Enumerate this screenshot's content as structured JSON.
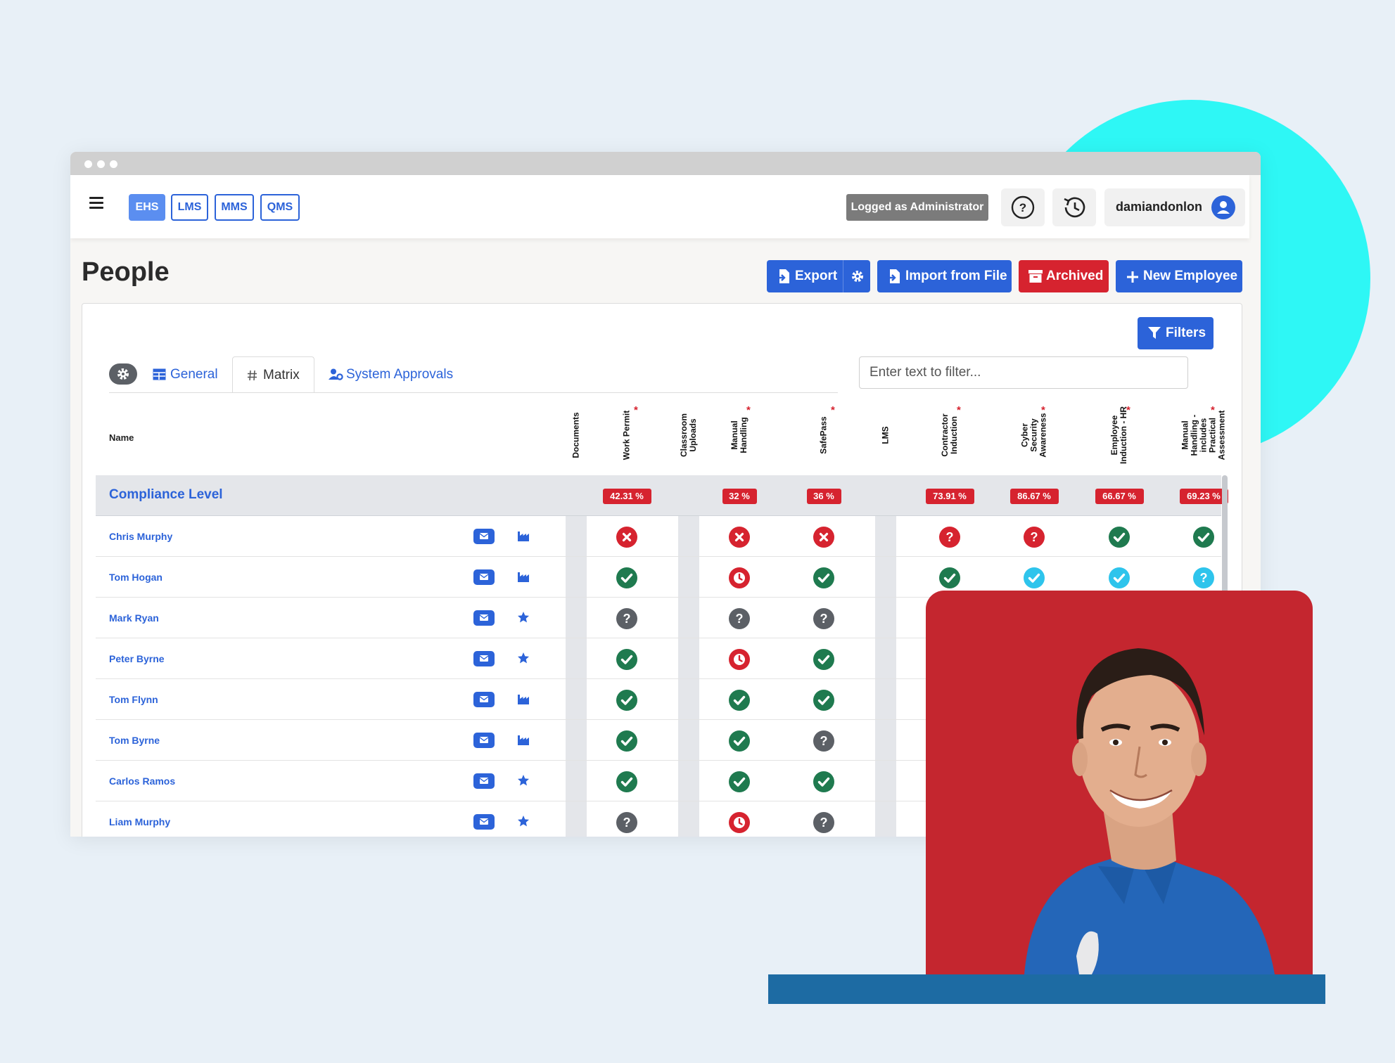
{
  "modules": [
    "EHS",
    "LMS",
    "MMS",
    "QMS"
  ],
  "header": {
    "logged_as": "Logged as Administrator",
    "username": "damiandonlon"
  },
  "page": {
    "title": "People",
    "export_label": "Export",
    "import_label": "Import from File",
    "archived_label": "Archived",
    "new_employee_label": "New Employee"
  },
  "card": {
    "filters_label": "Filters",
    "tabs": [
      "General",
      "Matrix",
      "System Approvals"
    ],
    "active_tab": "Matrix",
    "filter_placeholder": "Enter text to filter...",
    "name_header": "Name"
  },
  "columns": [
    {
      "label": "Documents",
      "required": false,
      "band": true
    },
    {
      "label": "Work Permit",
      "required": true,
      "band": false
    },
    {
      "label": "Classroom Uploads",
      "required": false,
      "band": true
    },
    {
      "label": "Manual Handling",
      "required": true,
      "band": false
    },
    {
      "label": "SafePass",
      "required": true,
      "band": false
    },
    {
      "label": "LMS",
      "required": false,
      "band": true
    },
    {
      "label": "Contractor Induction",
      "required": true,
      "band": false
    },
    {
      "label": "Cyber Security Awareness",
      "required": true,
      "band": false
    },
    {
      "label": "Employee Induction - HR",
      "required": true,
      "band": false
    },
    {
      "label": "Manual Handling - includes Practical Assessment",
      "required": true,
      "band": false
    }
  ],
  "compliance": {
    "label": "Compliance Level",
    "values": [
      "",
      "42.31 %",
      "",
      "32 %",
      "36 %",
      "",
      "73.91 %",
      "86.67 %",
      "66.67 %",
      "69.23 %"
    ]
  },
  "employees": [
    {
      "name": "Chris Murphy",
      "icon": "factory",
      "status": [
        "",
        "fail",
        "",
        "fail",
        "fail",
        "",
        "unknown-red",
        "unknown-red",
        "pass",
        "pass"
      ]
    },
    {
      "name": "Tom Hogan",
      "icon": "factory",
      "status": [
        "",
        "pass",
        "",
        "pending",
        "pass",
        "",
        "pass",
        "approved",
        "approved",
        "unknown-cyan"
      ]
    },
    {
      "name": "Mark Ryan",
      "icon": "star",
      "status": [
        "",
        "unknown-grey",
        "",
        "unknown-grey",
        "unknown-grey",
        "",
        "pass",
        "",
        "",
        ""
      ]
    },
    {
      "name": "Peter Byrne",
      "icon": "star",
      "status": [
        "",
        "pass",
        "",
        "pending",
        "pass",
        "",
        "unknown-red",
        "",
        "",
        ""
      ]
    },
    {
      "name": "Tom Flynn",
      "icon": "factory",
      "status": [
        "",
        "pass",
        "",
        "pass",
        "pass",
        "",
        "pass",
        "",
        "",
        ""
      ]
    },
    {
      "name": "Tom Byrne",
      "icon": "factory",
      "status": [
        "",
        "pass",
        "",
        "pass",
        "unknown-grey",
        "",
        "pass",
        "",
        "",
        ""
      ]
    },
    {
      "name": "Carlos Ramos",
      "icon": "star",
      "status": [
        "",
        "pass",
        "",
        "pass",
        "pass",
        "",
        "pass",
        "",
        "",
        ""
      ]
    },
    {
      "name": "Liam Murphy",
      "icon": "star",
      "status": [
        "",
        "unknown-grey",
        "",
        "pending",
        "unknown-grey",
        "",
        "pass",
        "",
        "",
        ""
      ]
    }
  ],
  "colors": {
    "primary": "#2c63d9",
    "danger": "#d6232f",
    "success": "#1f7a4f",
    "cyan": "#2ec4ec",
    "grey": "#5c6066",
    "accent_circle": "#2ef7f5",
    "photo_bg": "#c4262f"
  }
}
